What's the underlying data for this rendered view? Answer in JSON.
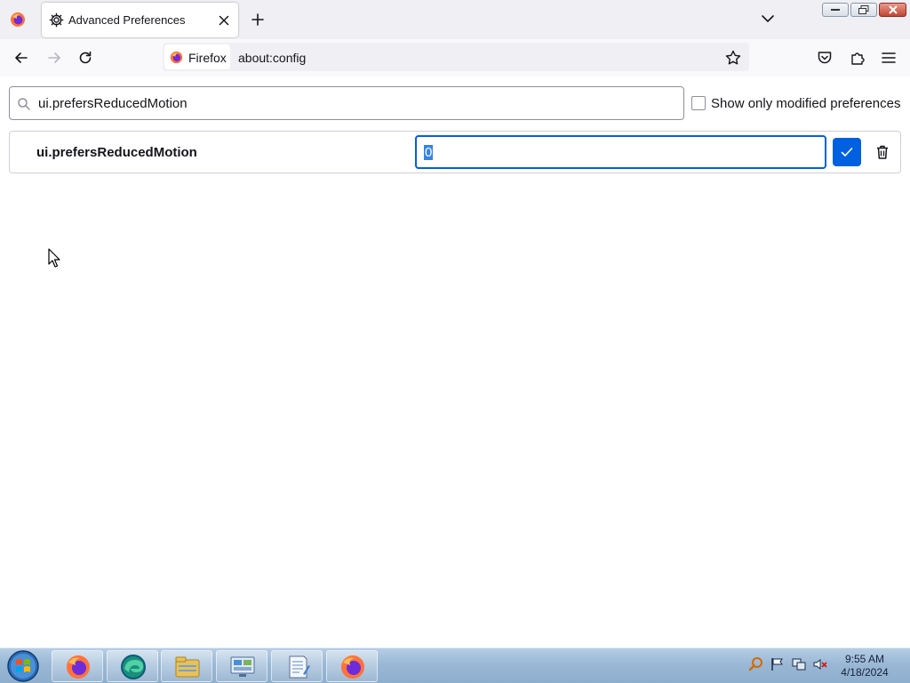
{
  "window": {
    "tab_title": "Advanced Preferences"
  },
  "toolbar": {
    "identity_label": "Firefox",
    "url": "about:config"
  },
  "search": {
    "value": "ui.prefersReducedMotion"
  },
  "filter": {
    "label": "Show only modified preferences",
    "checked": false
  },
  "preference": {
    "name": "ui.prefersReducedMotion",
    "edit_value": "0"
  },
  "taskbar": {
    "apps": [
      "firefox-icon",
      "edge-icon",
      "file-explorer-icon",
      "control-panel-icon",
      "notepad-icon",
      "firefox-icon"
    ],
    "clock_time": "9:55 AM",
    "clock_date": "4/18/2024"
  },
  "colors": {
    "accent": "#0061e0",
    "tabstrip": "#f0f0f4",
    "selection": "#3584e4"
  }
}
